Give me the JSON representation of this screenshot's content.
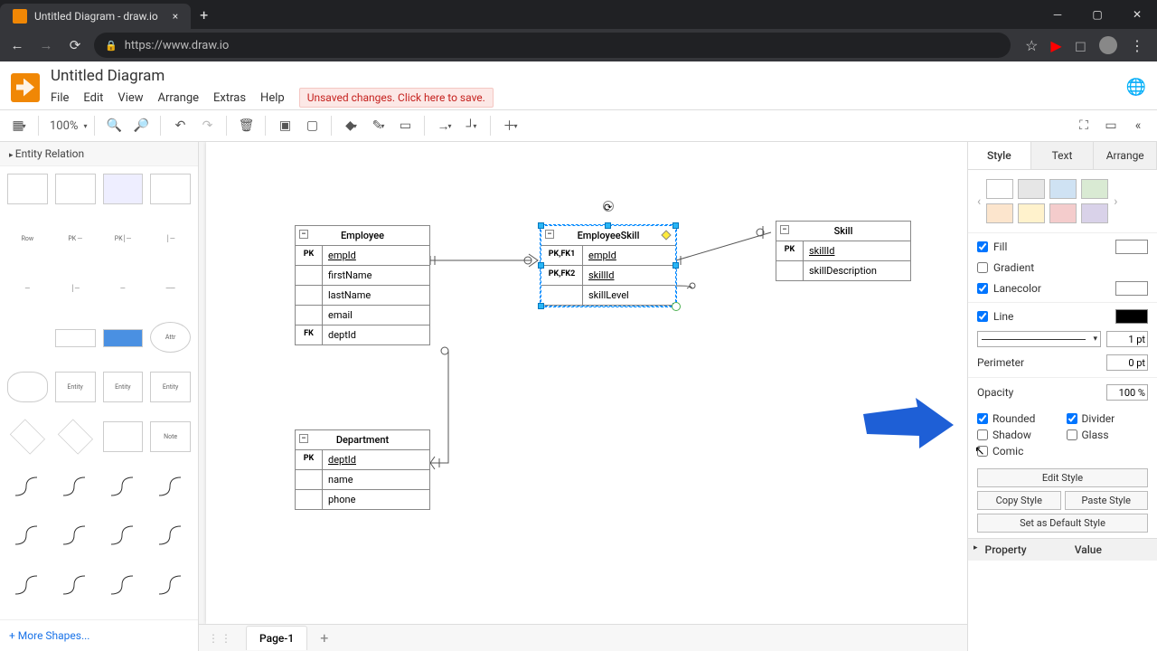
{
  "browser": {
    "tab_title": "Untitled Diagram - draw.io",
    "url": "https://www.draw.io"
  },
  "app": {
    "title": "Untitled Diagram",
    "menu": [
      "File",
      "Edit",
      "View",
      "Arrange",
      "Extras",
      "Help"
    ],
    "unsaved": "Unsaved changes. Click here to save.",
    "zoom": "100%"
  },
  "sidebar": {
    "section": "Entity Relation",
    "row_label": "Row",
    "more": "More Shapes..."
  },
  "canvas": {
    "entities": {
      "employee": {
        "name": "Employee",
        "rows": [
          {
            "key": "PK",
            "val": "empId",
            "u": true
          },
          {
            "key": "",
            "val": "firstName"
          },
          {
            "key": "",
            "val": "lastName"
          },
          {
            "key": "",
            "val": "email"
          },
          {
            "key": "FK",
            "val": "deptId"
          }
        ]
      },
      "empskill": {
        "name": "EmployeeSkill",
        "rows": [
          {
            "key": "PK,FK1",
            "val": "empId",
            "u": true
          },
          {
            "key": "PK,FK2",
            "val": "skillId",
            "u": true
          },
          {
            "key": "",
            "val": "skillLevel"
          }
        ]
      },
      "skill": {
        "name": "Skill",
        "rows": [
          {
            "key": "PK",
            "val": "skillId",
            "u": true
          },
          {
            "key": "",
            "val": "skillDescription"
          }
        ]
      },
      "department": {
        "name": "Department",
        "rows": [
          {
            "key": "PK",
            "val": "deptId",
            "u": true
          },
          {
            "key": "",
            "val": "name"
          },
          {
            "key": "",
            "val": "phone"
          }
        ]
      }
    },
    "page": "Page-1"
  },
  "format": {
    "tabs": [
      "Style",
      "Text",
      "Arrange"
    ],
    "swatches_top": [
      "#ffffff",
      "#e6e6e6",
      "#cfe2f3",
      "#d9ead3"
    ],
    "swatches_bot": [
      "#fce5cd",
      "#fff2cc",
      "#f4cccc",
      "#d9d2e9"
    ],
    "fill": {
      "label": "Fill",
      "checked": true,
      "color": "#ffffff"
    },
    "gradient": {
      "label": "Gradient",
      "checked": false
    },
    "lanecolor": {
      "label": "Lanecolor",
      "checked": true,
      "color": "#ffffff"
    },
    "line": {
      "label": "Line",
      "checked": true,
      "color": "#000000",
      "width": "1 pt"
    },
    "perimeter": {
      "label": "Perimeter",
      "value": "0 pt"
    },
    "opacity": {
      "label": "Opacity",
      "value": "100 %"
    },
    "checks": {
      "rounded": {
        "label": "Rounded",
        "checked": true
      },
      "divider": {
        "label": "Divider",
        "checked": true
      },
      "shadow": {
        "label": "Shadow",
        "checked": false
      },
      "glass": {
        "label": "Glass",
        "checked": false
      },
      "comic": {
        "label": "Comic",
        "checked": false
      }
    },
    "buttons": {
      "edit": "Edit Style",
      "copy": "Copy Style",
      "paste": "Paste Style",
      "default": "Set as Default Style"
    },
    "prop_cols": [
      "Property",
      "Value"
    ]
  }
}
